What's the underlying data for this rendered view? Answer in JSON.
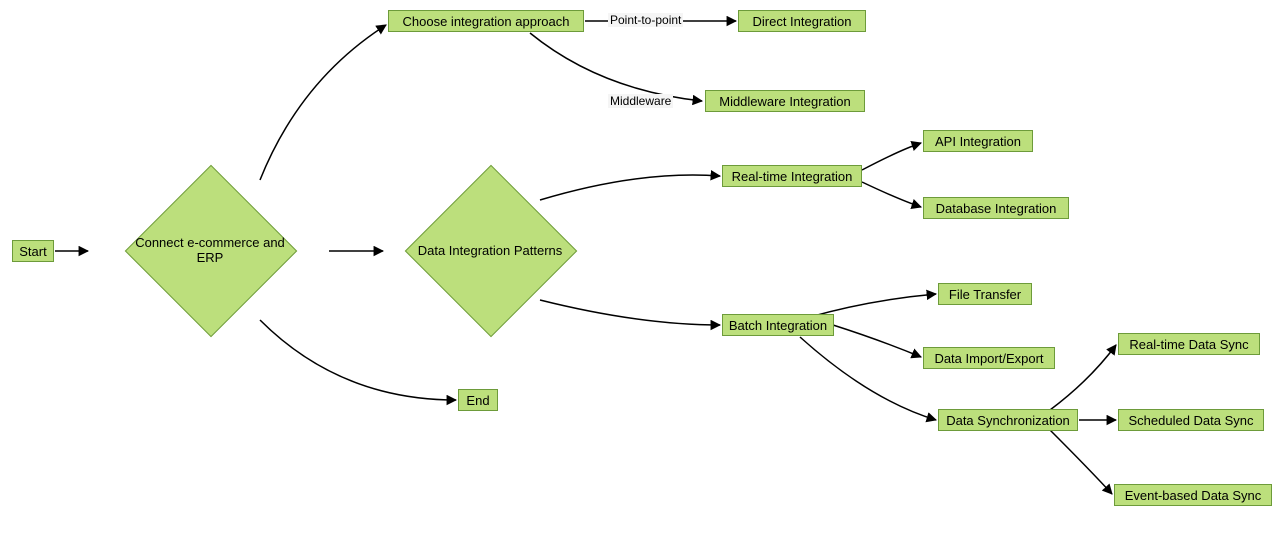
{
  "chart_data": {
    "type": "flowchart",
    "nodes": [
      {
        "id": "start",
        "label": "Start",
        "shape": "rect"
      },
      {
        "id": "connect",
        "label": "Connect e-commerce and ERP",
        "shape": "diamond"
      },
      {
        "id": "choose",
        "label": "Choose integration approach",
        "shape": "rect"
      },
      {
        "id": "direct",
        "label": "Direct Integration",
        "shape": "rect"
      },
      {
        "id": "middleware",
        "label": "Middleware Integration",
        "shape": "rect"
      },
      {
        "id": "patterns",
        "label": "Data Integration Patterns",
        "shape": "diamond"
      },
      {
        "id": "realtime",
        "label": "Real-time Integration",
        "shape": "rect"
      },
      {
        "id": "api",
        "label": "API Integration",
        "shape": "rect"
      },
      {
        "id": "db",
        "label": "Database Integration",
        "shape": "rect"
      },
      {
        "id": "batch",
        "label": "Batch Integration",
        "shape": "rect"
      },
      {
        "id": "file",
        "label": "File Transfer",
        "shape": "rect"
      },
      {
        "id": "importexport",
        "label": "Data Import/Export",
        "shape": "rect"
      },
      {
        "id": "sync",
        "label": "Data Synchronization",
        "shape": "rect"
      },
      {
        "id": "rtsync",
        "label": "Real-time Data Sync",
        "shape": "rect"
      },
      {
        "id": "schedsync",
        "label": "Scheduled Data Sync",
        "shape": "rect"
      },
      {
        "id": "eventsync",
        "label": "Event-based Data Sync",
        "shape": "rect"
      },
      {
        "id": "end",
        "label": "End",
        "shape": "rect"
      }
    ],
    "edges": [
      {
        "from": "start",
        "to": "connect"
      },
      {
        "from": "connect",
        "to": "choose"
      },
      {
        "from": "connect",
        "to": "patterns"
      },
      {
        "from": "connect",
        "to": "end"
      },
      {
        "from": "choose",
        "to": "direct",
        "label": "Point-to-point"
      },
      {
        "from": "choose",
        "to": "middleware",
        "label": "Middleware"
      },
      {
        "from": "patterns",
        "to": "realtime"
      },
      {
        "from": "patterns",
        "to": "batch"
      },
      {
        "from": "realtime",
        "to": "api"
      },
      {
        "from": "realtime",
        "to": "db"
      },
      {
        "from": "batch",
        "to": "file"
      },
      {
        "from": "batch",
        "to": "importexport"
      },
      {
        "from": "batch",
        "to": "sync"
      },
      {
        "from": "sync",
        "to": "rtsync"
      },
      {
        "from": "sync",
        "to": "schedsync"
      },
      {
        "from": "sync",
        "to": "eventsync"
      }
    ]
  },
  "nodes": {
    "start": "Start",
    "connect": "Connect e-commerce and ERP",
    "choose": "Choose integration approach",
    "direct": "Direct Integration",
    "middleware": "Middleware Integration",
    "patterns": "Data Integration Patterns",
    "realtime": "Real-time Integration",
    "api": "API Integration",
    "db": "Database Integration",
    "batch": "Batch Integration",
    "file": "File Transfer",
    "importexport": "Data Import/Export",
    "sync": "Data Synchronization",
    "rtsync": "Real-time Data Sync",
    "schedsync": "Scheduled Data Sync",
    "eventsync": "Event-based Data Sync",
    "end": "End"
  },
  "edgeLabels": {
    "p2p": "Point-to-point",
    "mw": "Middleware"
  }
}
